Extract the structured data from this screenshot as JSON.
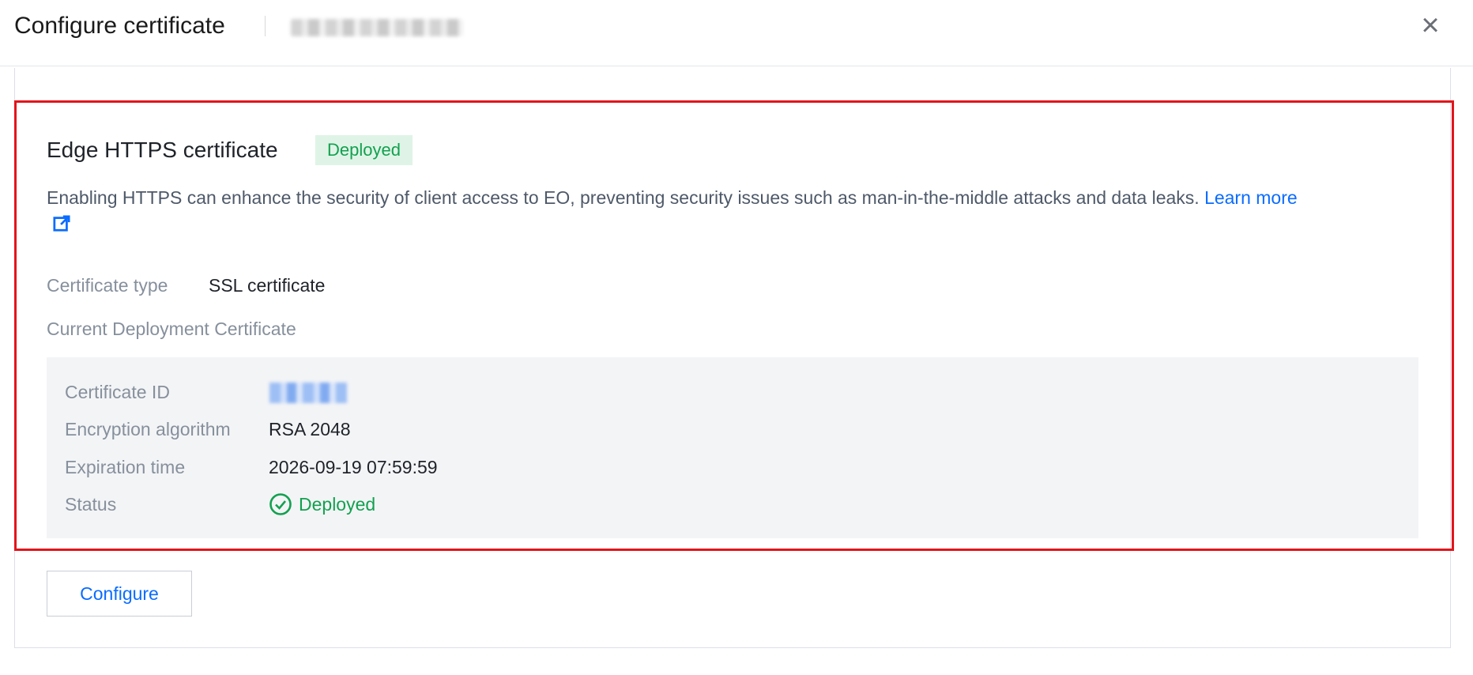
{
  "header": {
    "title": "Configure certificate",
    "close_icon": "close-icon"
  },
  "section": {
    "title": "Edge HTTPS certificate",
    "badge": "Deployed",
    "description": "Enabling HTTPS can enhance the security of client access to EO, preventing security issues such as man-in-the-middle attacks and data leaks.",
    "learn_more": "Learn more",
    "learn_more_icon": "external-link-icon"
  },
  "cert_type": {
    "label": "Certificate type",
    "value": "SSL certificate"
  },
  "current_deployment": {
    "label": "Current Deployment Certificate"
  },
  "details": {
    "certificate_id_label": "Certificate ID",
    "encryption_label": "Encryption algorithm",
    "encryption_value": "RSA 2048",
    "expiration_label": "Expiration time",
    "expiration_value": "2026-09-19 07:59:59",
    "status_label": "Status",
    "status_value": "Deployed",
    "status_icon": "check-circle-icon"
  },
  "actions": {
    "configure": "Configure"
  },
  "colors": {
    "accent": "#0a6cff",
    "success": "#12a150",
    "highlight_border": "#e3141b"
  }
}
